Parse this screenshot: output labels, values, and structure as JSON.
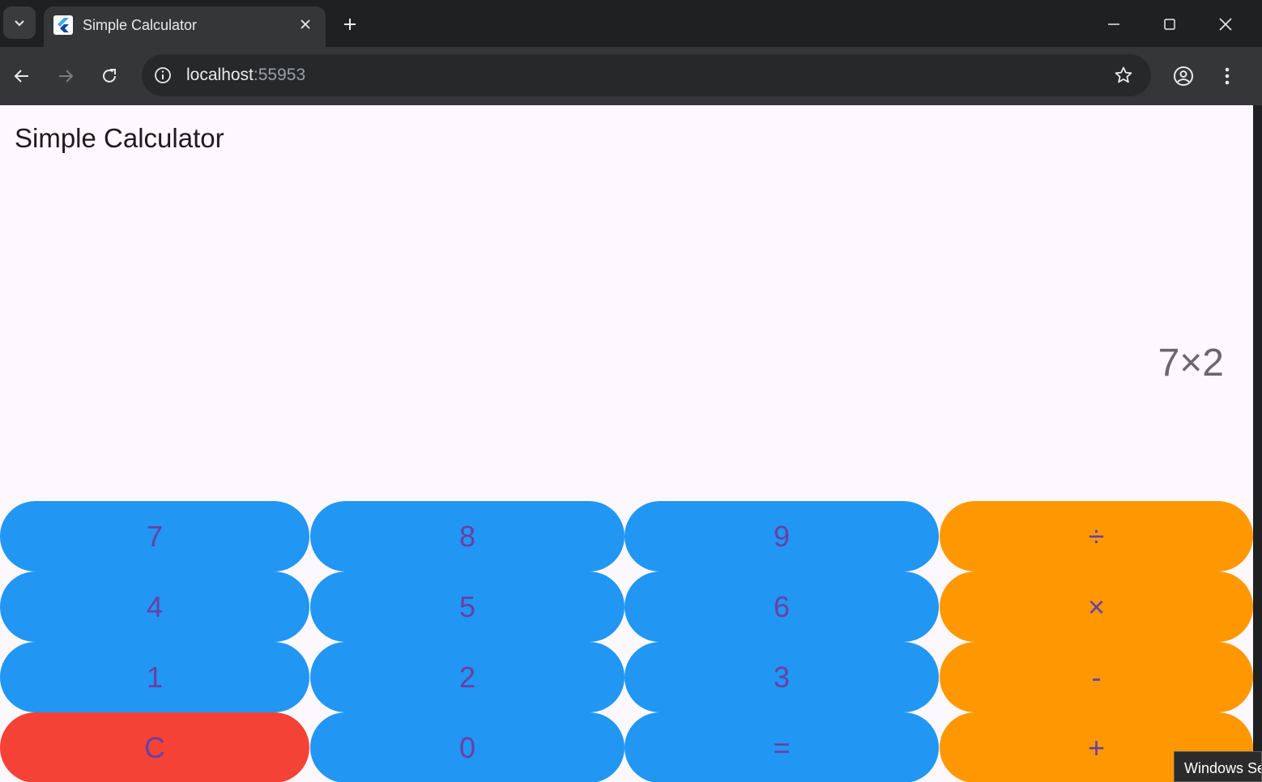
{
  "browser": {
    "tab": {
      "title": "Simple Calculator"
    },
    "url": {
      "host": "localhost",
      "port": ":55953"
    }
  },
  "app": {
    "title": "Simple Calculator",
    "display": "7×2"
  },
  "keypad": {
    "rows": [
      [
        "7",
        "8",
        "9",
        "÷"
      ],
      [
        "4",
        "5",
        "6",
        "×"
      ],
      [
        "1",
        "2",
        "3",
        "-"
      ],
      [
        "C",
        "0",
        "=",
        "+"
      ]
    ]
  },
  "colors": {
    "number_key": "#2196f3",
    "operator_key": "#ff9800",
    "clear_key": "#f44336",
    "key_text": "#6a3fa5",
    "page_background": "#fdf7fe"
  },
  "tooltip": {
    "text": "Windows Se"
  }
}
